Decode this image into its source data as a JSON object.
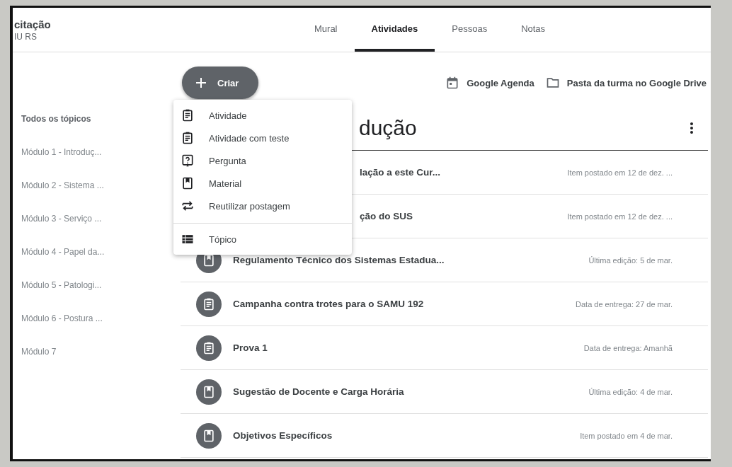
{
  "header": {
    "title": "citação",
    "subtitle": "IU RS"
  },
  "tabs": [
    {
      "label": "Mural",
      "selected": false
    },
    {
      "label": "Atividades",
      "selected": true
    },
    {
      "label": "Pessoas",
      "selected": false
    },
    {
      "label": "Notas",
      "selected": false
    }
  ],
  "create_button": {
    "label": "Criar"
  },
  "links": [
    {
      "kind": "calendar",
      "label": "Google Agenda"
    },
    {
      "kind": "folder",
      "label": "Pasta da turma no Google Drive"
    }
  ],
  "sidebar": {
    "items": [
      {
        "label": "Todos os tópicos",
        "selected": true
      },
      {
        "label": "Módulo 1 - Introduç...",
        "selected": false
      },
      {
        "label": "Módulo 2 - Sistema ...",
        "selected": false
      },
      {
        "label": "Módulo 3 - Serviço ...",
        "selected": false
      },
      {
        "label": "Módulo 4 - Papel da...",
        "selected": false
      },
      {
        "label": "Módulo 5 - Patologi...",
        "selected": false
      },
      {
        "label": "Módulo 6 - Postura ...",
        "selected": false
      },
      {
        "label": "Módulo 7",
        "selected": false
      }
    ]
  },
  "topic": {
    "title": "dução"
  },
  "posts": [
    {
      "title": "lação a este Cur...",
      "meta": "Item postado em 12 de dez. ..."
    },
    {
      "title": "ção do SUS",
      "meta": "Item postado em 12 de dez. ..."
    },
    {
      "kind": "material",
      "title": "Regulamento Técnico dos Sistemas Estadua...",
      "meta": "Última edição: 5 de mar."
    },
    {
      "kind": "assignment",
      "title": "Campanha contra trotes para o SAMU 192",
      "meta": "Data de entrega: 27 de mar."
    },
    {
      "kind": "assignment",
      "title": "Prova 1",
      "meta": "Data de entrega: Amanhã"
    },
    {
      "kind": "material",
      "title": "Sugestão de Docente e Carga Horária",
      "meta": "Última edição: 4 de mar."
    },
    {
      "kind": "material",
      "title": "Objetivos Específicos",
      "meta": "Item postado em 4 de mar."
    }
  ],
  "create_menu": {
    "items": [
      {
        "kind": "assignment",
        "label": "Atividade"
      },
      {
        "kind": "assignment",
        "label": "Atividade com teste"
      },
      {
        "kind": "question",
        "label": "Pergunta"
      },
      {
        "kind": "material",
        "label": "Material"
      },
      {
        "kind": "reuse",
        "label": "Reutilizar postagem"
      },
      {
        "kind": "topic",
        "label": "Tópico"
      }
    ]
  }
}
